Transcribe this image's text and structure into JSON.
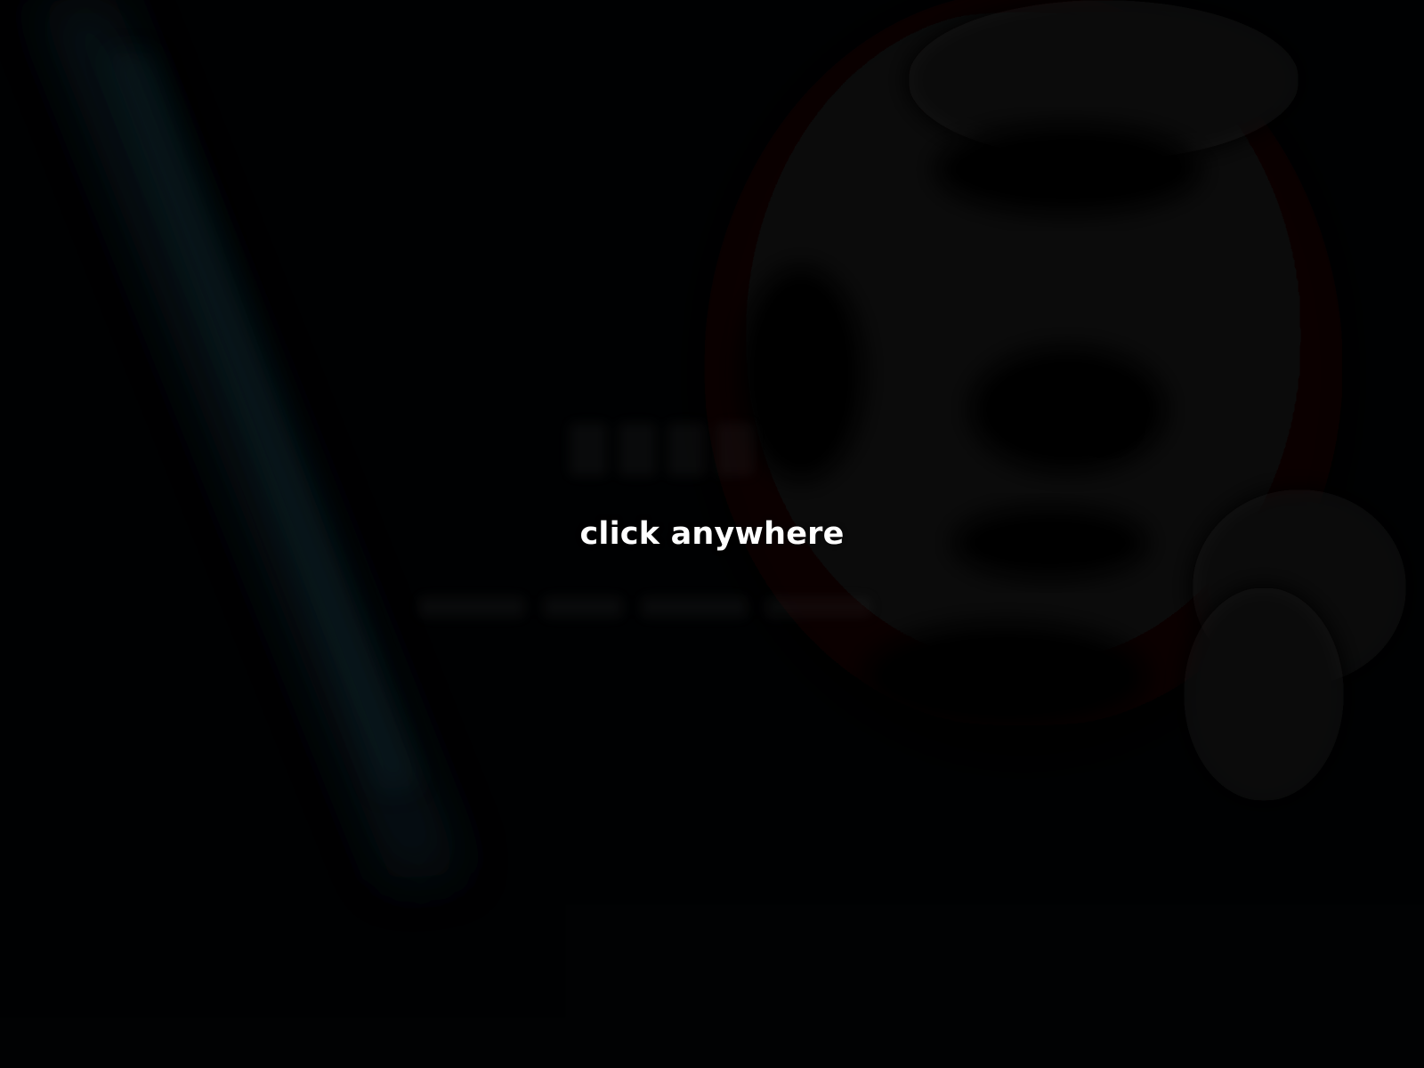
{
  "screen": {
    "prompt_text": "click anywhere",
    "background_color": "#010203",
    "prompt_color": "#ffffff",
    "accent_glow_color": "#0b2a33",
    "figure_tint_color": "#0d0b0b"
  }
}
